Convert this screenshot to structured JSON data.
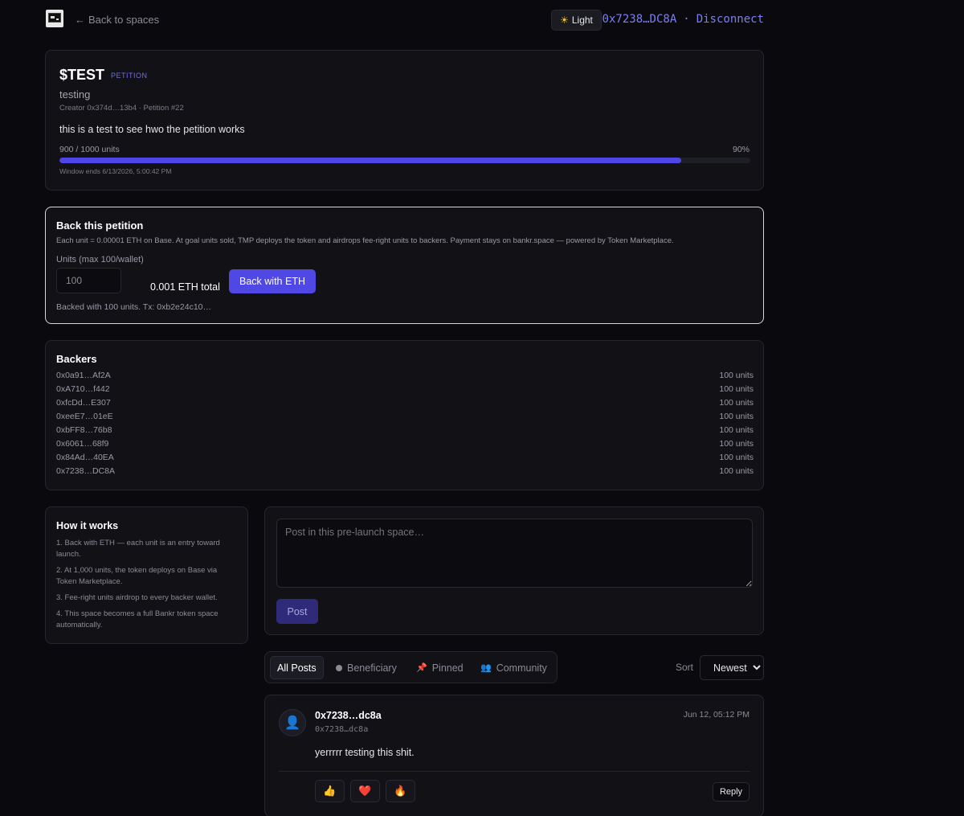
{
  "header": {
    "back_label": "Back to spaces",
    "theme_label": "Light",
    "wallet_address": "0x7238…DC8A",
    "disconnect_label": "Disconnect"
  },
  "petition": {
    "ticker": "$TEST",
    "badge": "PETITION",
    "name": "testing",
    "meta": "Creator 0x374d…13b4 · Petition #22",
    "description": "this is a test to see hwo the petition works",
    "units_text": "900 / 1000 units",
    "percent_text": "90%",
    "progress": 0.9,
    "window_text": "Window ends 6/13/2026, 5:00:42 PM"
  },
  "back": {
    "title": "Back this petition",
    "description": "Each unit = 0.00001 ETH on Base. At goal units sold, TMP deploys the token and airdrops fee-right units to backers. Payment stays on bankr.space — powered by Token Marketplace.",
    "units_label": "Units (max 100/wallet)",
    "units_value": "100",
    "total_text": "0.001 ETH total",
    "button_label": "Back with ETH",
    "status_text": "Backed with 100 units. Tx: 0xb2e24c10…"
  },
  "backers": {
    "title": "Backers",
    "rows": [
      {
        "address": "0x0a91…Af2A",
        "units": "100 units"
      },
      {
        "address": "0xA710…f442",
        "units": "100 units"
      },
      {
        "address": "0xfcDd…E307",
        "units": "100 units"
      },
      {
        "address": "0xeeE7…01eE",
        "units": "100 units"
      },
      {
        "address": "0xbFF8…76b8",
        "units": "100 units"
      },
      {
        "address": "0x6061…68f9",
        "units": "100 units"
      },
      {
        "address": "0x84Ad…40EA",
        "units": "100 units"
      },
      {
        "address": "0x7238…DC8A",
        "units": "100 units"
      }
    ]
  },
  "how": {
    "title": "How it works",
    "steps": [
      "1. Back with ETH — each unit is an entry toward launch.",
      "2. At 1,000 units, the token deploys on Base via Token Marketplace.",
      "3. Fee-right units airdrop to every backer wallet.",
      "4. This space becomes a full Bankr token space automatically."
    ]
  },
  "composer": {
    "placeholder": "Post in this pre-launch space…",
    "post_label": "Post"
  },
  "tabs": {
    "all": "All Posts",
    "beneficiary": "Beneficiary",
    "pinned": "Pinned",
    "community": "Community"
  },
  "sort": {
    "label": "Sort",
    "selected": "Newest"
  },
  "post": {
    "author": "0x7238…dc8a",
    "handle": "0x7238…dc8a",
    "time": "Jun 12, 05:12 PM",
    "body": "yerrrrr testing this shit.",
    "reactions": [
      "👍",
      "❤️",
      "🔥"
    ],
    "reply_label": "Reply"
  },
  "colors": {
    "accent": "#5048e5",
    "accent_text": "#7b7ff0",
    "background": "#0a0a0e",
    "card": "#111116"
  }
}
